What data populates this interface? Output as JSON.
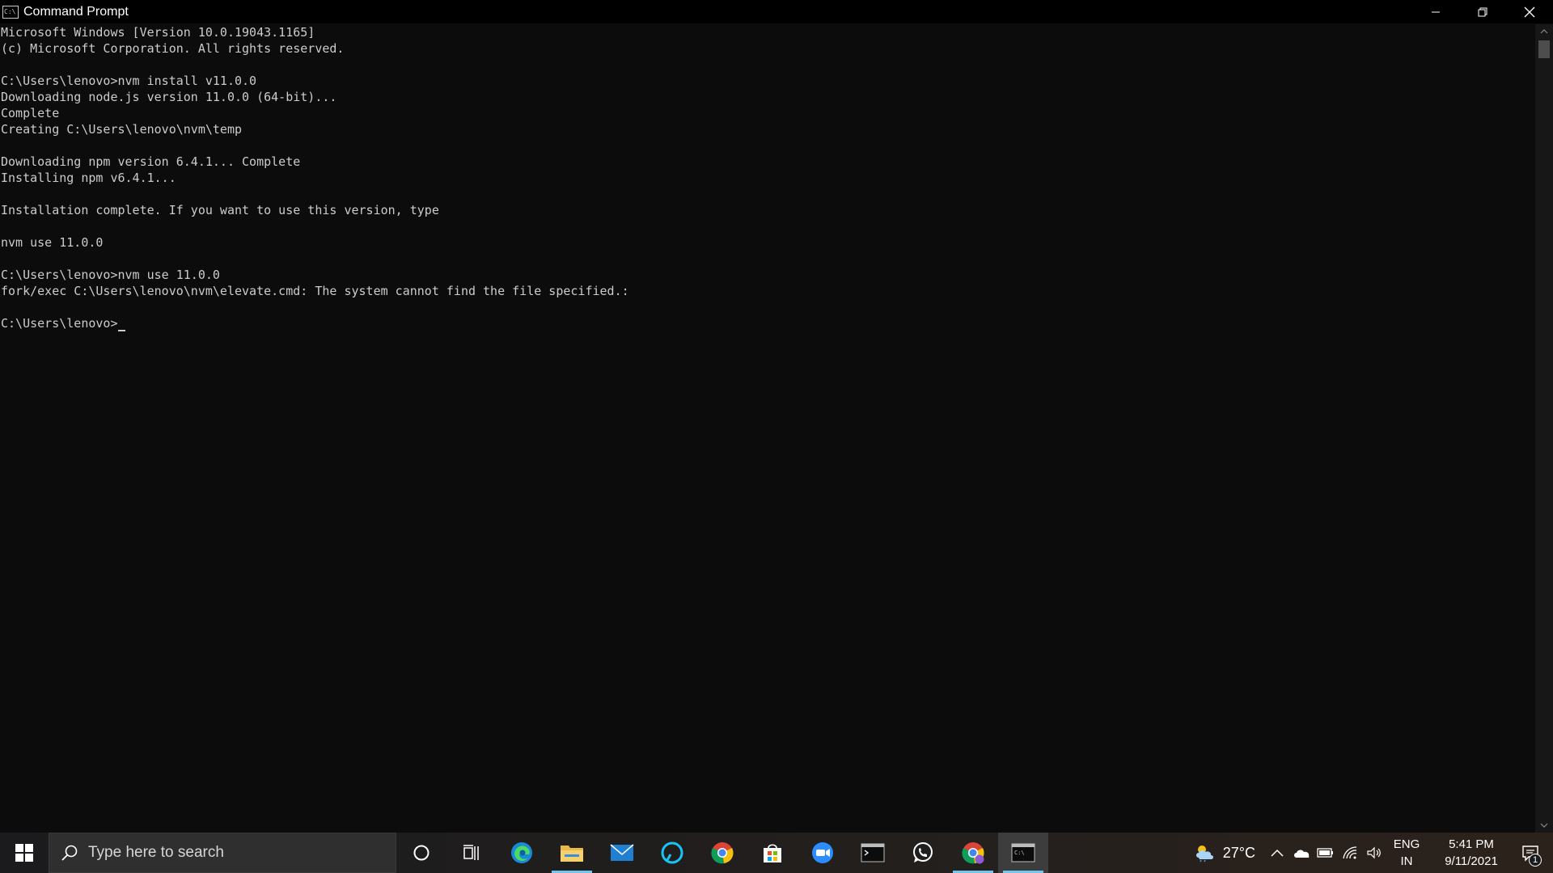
{
  "window": {
    "title": "Command Prompt",
    "app_icon_text": "C:\\",
    "icons": {
      "minimize": "minimize-icon",
      "restore": "restore-icon",
      "close": "close-icon"
    }
  },
  "console": {
    "lines": [
      "Microsoft Windows [Version 10.0.19043.1165]",
      "(c) Microsoft Corporation. All rights reserved.",
      "",
      "C:\\Users\\lenovo>nvm install v11.0.0",
      "Downloading node.js version 11.0.0 (64-bit)...",
      "Complete",
      "Creating C:\\Users\\lenovo\\nvm\\temp",
      "",
      "Downloading npm version 6.4.1... Complete",
      "Installing npm v6.4.1...",
      "",
      "Installation complete. If you want to use this version, type",
      "",
      "nvm use 11.0.0",
      "",
      "C:\\Users\\lenovo>nvm use 11.0.0",
      "fork/exec C:\\Users\\lenovo\\nvm\\elevate.cmd: The system cannot find the file specified.:",
      "",
      "C:\\Users\\lenovo>"
    ],
    "text_color": "#cccccc",
    "background_color": "#0c0c0c"
  },
  "taskbar": {
    "search_placeholder": "Type here to search",
    "apps": [
      {
        "name": "cortana",
        "icon": "cortana-circle-icon",
        "running": false,
        "active": false
      },
      {
        "name": "task-view",
        "icon": "task-view-icon",
        "running": false,
        "active": false
      },
      {
        "name": "edge",
        "icon": "edge-icon",
        "running": false,
        "active": false
      },
      {
        "name": "file-explorer",
        "icon": "folder-icon",
        "running": true,
        "active": false
      },
      {
        "name": "mail",
        "icon": "mail-icon",
        "running": false,
        "active": false
      },
      {
        "name": "alexa",
        "icon": "alexa-icon",
        "running": false,
        "active": false
      },
      {
        "name": "chrome",
        "icon": "chrome-icon",
        "running": false,
        "active": false
      },
      {
        "name": "store",
        "icon": "store-icon",
        "running": false,
        "active": false
      },
      {
        "name": "zoom",
        "icon": "zoom-icon",
        "running": false,
        "active": false
      },
      {
        "name": "terminal",
        "icon": "terminal-icon",
        "running": false,
        "active": false
      },
      {
        "name": "whatsapp",
        "icon": "whatsapp-icon",
        "running": false,
        "active": false
      },
      {
        "name": "chrome-profile",
        "icon": "chrome-profile-icon",
        "running": true,
        "active": false
      },
      {
        "name": "command-prompt",
        "icon": "command-prompt-icon",
        "running": true,
        "active": true
      }
    ],
    "tray": {
      "temperature": "27°C",
      "language": "ENG",
      "region": "IN",
      "time": "5:41 PM",
      "date": "9/11/2021",
      "notification_count": "1"
    },
    "accent_color": "#6fc7f0"
  }
}
